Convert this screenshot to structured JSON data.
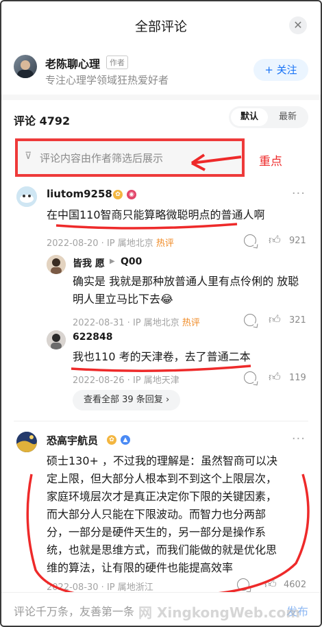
{
  "header": {
    "title": "全部评论",
    "close_label": "✕"
  },
  "author": {
    "name": "老陈聊心理",
    "tag": "作者",
    "description": "专注心理学领域狂热爱好者",
    "follow_label": "+ 关注"
  },
  "comments_header": {
    "count_label": "评论 4792",
    "sort_default": "默认",
    "sort_newest": "最新"
  },
  "filter_notice": {
    "icon": "funnel-icon",
    "text": "评论内容由作者筛选后展示"
  },
  "annotation": {
    "label": "重点",
    "color": "#ee2a2a"
  },
  "comments": [
    {
      "user": "liutom9258",
      "text": "在中国110智商只能算略微聪明点的普通人啊",
      "date": "2022-08-20 · IP 属地北京",
      "hot": "热评",
      "likes": "921",
      "replies": [
        {
          "user": "皆我 愿",
          "reply_to": "Q00",
          "text_line1": "确实是 我就是那种放普通人里有点伶俐的 放聪",
          "text_line2": "明人里立马比下去😂",
          "date": "2022-08-31 · IP 属地北京",
          "hot": "热评",
          "likes": "321"
        },
        {
          "user": "622848",
          "text": "我也110 考的天津卷，去了普通二本",
          "date": "2022-08-26 · IP 属地天津",
          "likes": "119"
        }
      ],
      "view_replies": "查看全部 39 条回复 ›"
    },
    {
      "user": "恐高宇航员",
      "lines": [
        "硕士130+ ，不过我的理解是：虽然智商可以决",
        "定上限，但大部分人根本到不到这个上限层次，",
        "家庭环境层次才是真正决定你下限的关键因素，",
        "而大部分人只能在下限波动。而智力也分两部",
        "分，一部分是硬件天生的，另一部分是操作系",
        "统，也就是思维方式，而我们能做的就是优化思",
        "维的算法，让有限的硬件也能提高效率"
      ],
      "date": "2022-08-30 · IP 属地浙江",
      "likes": "4602"
    }
  ],
  "bottom_bar": {
    "placeholder": "评论千万条，友善第一条",
    "send_label": "发布"
  },
  "watermark": "网 XingkongWeb.com"
}
